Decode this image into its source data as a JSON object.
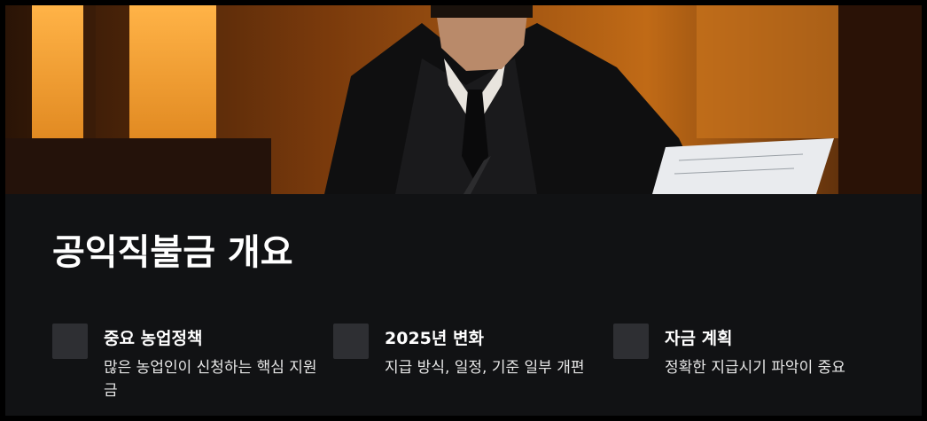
{
  "section": {
    "title": "공익직불금 개요"
  },
  "hero": {
    "image": "man-in-suit-reading-document"
  },
  "features": [
    {
      "icon": "square-icon",
      "title": "중요 농업정책",
      "description": "많은 농업인이 신청하는 핵심 지원금"
    },
    {
      "icon": "square-icon",
      "title": "2025년 변화",
      "description": "지급 방식, 일정, 기준 일부 개편"
    },
    {
      "icon": "square-icon",
      "title": "자금 계획",
      "description": "정확한 지급시기 파악이 중요"
    }
  ],
  "colors": {
    "background": "#111214",
    "icon_box": "#2e2f33",
    "text": "#ffffff"
  }
}
